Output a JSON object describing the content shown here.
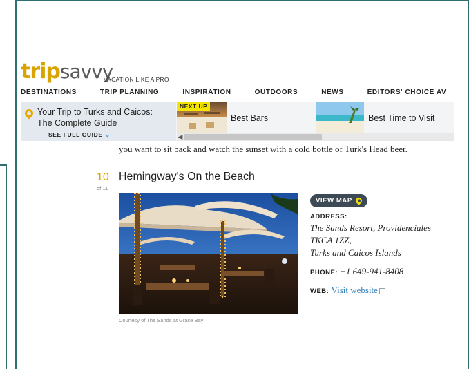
{
  "brand": {
    "logo_primary": "trip",
    "logo_secondary": "savvy",
    "tagline": "VACATION LIKE A PRO"
  },
  "nav": {
    "items": [
      {
        "label": "DESTINATIONS"
      },
      {
        "label": "TRIP PLANNING"
      },
      {
        "label": "INSPIRATION"
      },
      {
        "label": "OUTDOORS"
      },
      {
        "label": "NEWS"
      },
      {
        "label": "EDITORS' CHOICE AV"
      }
    ]
  },
  "guide": {
    "title": "Your Trip to Turks and Caicos: The Complete Guide",
    "link_label": "SEE FULL GUIDE",
    "next_up_tag": "NEXT UP",
    "related": [
      {
        "label": "Best Bars"
      },
      {
        "label": "Best Time to Visit"
      }
    ]
  },
  "article": {
    "lead_text": "you want to sit back and watch the sunset with a cold bottle of Turk's Head beer.",
    "item_number": "10",
    "item_of": "of 11",
    "item_title": "Hemingway's On the Beach",
    "photo_credit": "Courtesy of The Sands at Grace Bay",
    "view_map_label": "VIEW MAP",
    "address_label": "ADDRESS:",
    "address_lines": [
      "The Sands Resort, Providenciales",
      "TKCA 1ZZ,",
      "Turks and Caicos Islands"
    ],
    "phone_label": "PHONE:",
    "phone_value": "+1 649-941-8408",
    "web_label": "WEB:",
    "web_link": "Visit website"
  },
  "colors": {
    "brand_gold": "#d9a400",
    "frame": "#2f6f6f",
    "link_blue": "#2e7fb8",
    "map_button": "#3d4a55",
    "next_up_yellow": "#f3e500"
  }
}
